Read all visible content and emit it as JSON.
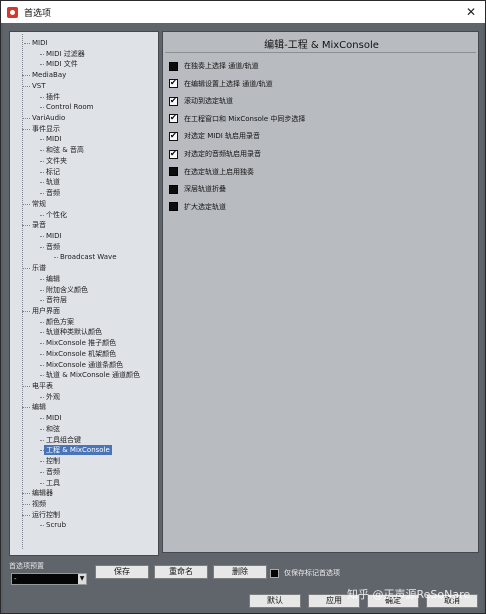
{
  "window": {
    "title": "首选项",
    "close_glyph": "✕"
  },
  "tree": {
    "items": [
      {
        "label": "MIDI",
        "level": 1
      },
      {
        "label": "MIDI 过滤器",
        "level": 2
      },
      {
        "label": "MIDI 文件",
        "level": 2
      },
      {
        "label": "MediaBay",
        "level": 0
      },
      {
        "label": "VST",
        "level": 0
      },
      {
        "label": "插件",
        "level": 2
      },
      {
        "label": "Control Room",
        "level": 2
      },
      {
        "label": "VariAudio",
        "level": 0
      },
      {
        "label": "事件显示",
        "level": 0
      },
      {
        "label": "MIDI",
        "level": 2
      },
      {
        "label": "和弦 & 音高",
        "level": 2
      },
      {
        "label": "文件夹",
        "level": 2
      },
      {
        "label": "标记",
        "level": 2
      },
      {
        "label": "轨道",
        "level": 2
      },
      {
        "label": "音频",
        "level": 2
      },
      {
        "label": "常规",
        "level": 0
      },
      {
        "label": "个性化",
        "level": 2
      },
      {
        "label": "录音",
        "level": 0
      },
      {
        "label": "MIDI",
        "level": 2
      },
      {
        "label": "音频",
        "level": 2
      },
      {
        "label": "Broadcast Wave",
        "level": 3
      },
      {
        "label": "乐谱",
        "level": 0
      },
      {
        "label": "编辑",
        "level": 2
      },
      {
        "label": "附加含义颜色",
        "level": 2
      },
      {
        "label": "音符层",
        "level": 2
      },
      {
        "label": "用户界面",
        "level": 0
      },
      {
        "label": "颜色方案",
        "level": 2
      },
      {
        "label": "轨道种类默认颜色",
        "level": 2
      },
      {
        "label": "MixConsole 推子颜色",
        "level": 2
      },
      {
        "label": "MixConsole 机架颜色",
        "level": 2
      },
      {
        "label": "MixConsole 通道条颜色",
        "level": 2
      },
      {
        "label": "轨道 & MixConsole 通道颜色",
        "level": 2
      },
      {
        "label": "电平表",
        "level": 0
      },
      {
        "label": "外观",
        "level": 2
      },
      {
        "label": "编辑",
        "level": 0
      },
      {
        "label": "MIDI",
        "level": 2
      },
      {
        "label": "和弦",
        "level": 2
      },
      {
        "label": "工具组合键",
        "level": 2
      },
      {
        "label": "工程 & MixConsole",
        "level": 2,
        "selected": true
      },
      {
        "label": "控制",
        "level": 2
      },
      {
        "label": "音频",
        "level": 2
      },
      {
        "label": "工具",
        "level": 2
      },
      {
        "label": "编辑器",
        "level": 0
      },
      {
        "label": "视频",
        "level": 0
      },
      {
        "label": "运行控制",
        "level": 0
      },
      {
        "label": "Scrub",
        "level": 2
      }
    ]
  },
  "panel": {
    "title": "编辑-工程 & MixConsole",
    "options": [
      {
        "label": "在独奏上选择 通道/轨道",
        "checked": false
      },
      {
        "label": "在编辑设置上选择 通道/轨道",
        "checked": true
      },
      {
        "label": "滚动到选定轨道",
        "checked": true
      },
      {
        "label": "在工程窗口和 MixConsole 中同步选择",
        "checked": true
      },
      {
        "label": "对选定 MIDI 轨启用录音",
        "checked": true
      },
      {
        "label": "对选定的音频轨启用录音",
        "checked": true
      },
      {
        "label": "在选定轨道上启用独奏",
        "checked": false
      },
      {
        "label": "深层轨道折叠",
        "checked": false
      },
      {
        "label": "扩大选定轨道",
        "checked": false
      }
    ]
  },
  "bottom": {
    "preset_label": "首选项预置",
    "preset_value": "-",
    "save_label": "保存",
    "rename_label": "重命名",
    "delete_label": "删除",
    "keep_label": "仅保存标记首选项",
    "default_label": "默认",
    "apply_label": "应用",
    "ok_label": "确定",
    "cancel_label": "取消",
    "watermark": "知乎 @正声源ReSoNare"
  },
  "colors": {
    "selection": "#4a74b8",
    "panel_bg": "#b8bcc1",
    "tree_bg": "#dfe3e8"
  }
}
